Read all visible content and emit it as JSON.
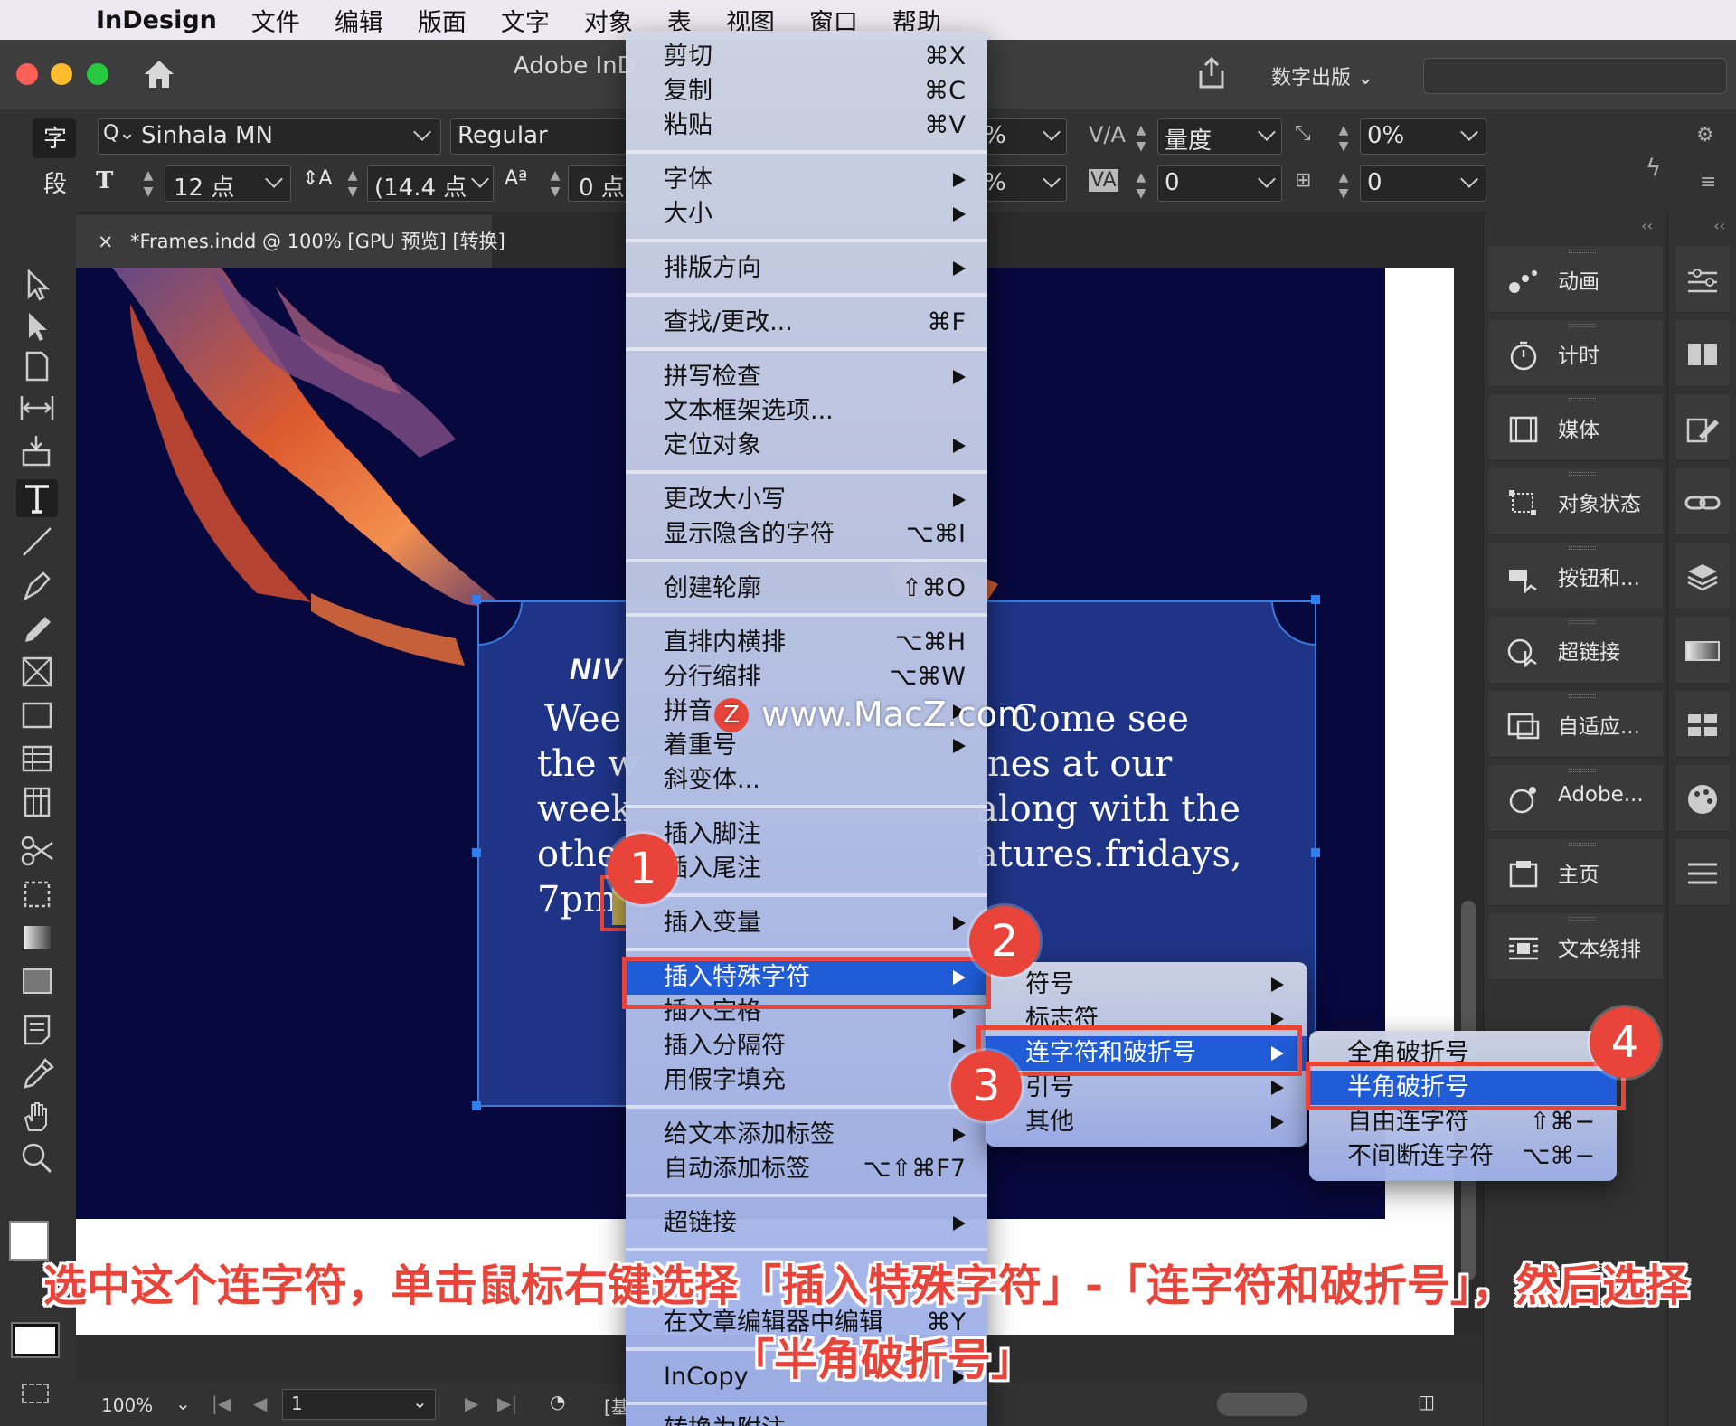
{
  "menubar": {
    "app": "InDesign",
    "items": [
      "文件",
      "编辑",
      "版面",
      "文字",
      "对象",
      "表",
      "视图",
      "窗口",
      "帮助"
    ]
  },
  "window": {
    "title": "Adobe InD",
    "publish_label": "数字出版"
  },
  "control": {
    "char_mode": "字",
    "para_mode": "段",
    "font_family": "Sinhala MN",
    "font_style": "Regular",
    "font_size": "12 点",
    "leading": "(14.4 点",
    "baseline_shift": "0 点",
    "scale_h": "%",
    "scale_v": "%",
    "kerning": "量度",
    "tracking": "0",
    "skew": "0%",
    "char_rotation": "0"
  },
  "tab": {
    "close": "×",
    "title": "*Frames.indd @ 100% [GPU 预览] [转换]"
  },
  "frame": {
    "title": "NIV",
    "lines": [
      "Wee",
      "the w",
      "week",
      "othe",
      "7pm"
    ],
    "right_lines": [
      "Come see",
      "nes at our",
      "along with the",
      "atures.fridays,"
    ]
  },
  "status": {
    "zoom": "100%",
    "page": "1",
    "base": "[基"
  },
  "right_panels": [
    {
      "label": "动画",
      "icon": "animation-icon"
    },
    {
      "label": "计时",
      "icon": "timer-icon"
    },
    {
      "label": "媒体",
      "icon": "media-icon"
    },
    {
      "label": "对象状态",
      "icon": "object-states-icon"
    },
    {
      "label": "按钮和...",
      "icon": "buttons-icon"
    },
    {
      "label": "超链接",
      "icon": "hyperlinks-icon"
    },
    {
      "label": "自适应...",
      "icon": "liquid-layout-icon"
    },
    {
      "label": "Adobe...",
      "icon": "adobe-color-icon"
    },
    {
      "label": "主页",
      "icon": "pages-icon"
    },
    {
      "label": "文本绕排",
      "icon": "text-wrap-icon"
    }
  ],
  "context_menu": {
    "items": [
      {
        "label": "剪切",
        "shortcut": "⌘X"
      },
      {
        "label": "复制",
        "shortcut": "⌘C"
      },
      {
        "label": "粘贴",
        "shortcut": "⌘V"
      },
      {
        "label": "字体",
        "submenu": true
      },
      {
        "label": "大小",
        "submenu": true
      },
      {
        "label": "排版方向",
        "submenu": true
      },
      {
        "label": "查找/更改...",
        "shortcut": "⌘F"
      },
      {
        "label": "拼写检查",
        "submenu": true
      },
      {
        "label": "文本框架选项..."
      },
      {
        "label": "定位对象",
        "submenu": true
      },
      {
        "label": "更改大小写",
        "submenu": true
      },
      {
        "label": "显示隐含的字符",
        "shortcut": "⌥⌘I"
      },
      {
        "label": "创建轮廓",
        "shortcut": "⇧⌘O"
      },
      {
        "label": "直排内横排",
        "shortcut": "⌥⌘H"
      },
      {
        "label": "分行缩排",
        "shortcut": "⌥⌘W"
      },
      {
        "label": "拼音",
        "submenu": true
      },
      {
        "label": "着重号",
        "submenu": true
      },
      {
        "label": "斜变体..."
      },
      {
        "label": "插入脚注"
      },
      {
        "label": "插入尾注"
      },
      {
        "label": "插入变量",
        "submenu": true
      },
      {
        "label": "插入特殊字符",
        "submenu": true,
        "selected": true
      },
      {
        "label": "插入空格",
        "submenu": true
      },
      {
        "label": "插入分隔符",
        "submenu": true
      },
      {
        "label": "用假字填充"
      },
      {
        "label": "给文本添加标签",
        "submenu": true
      },
      {
        "label": "自动添加标签",
        "shortcut": "⌥⇧⌘F7"
      },
      {
        "label": "超链接",
        "submenu": true
      },
      {
        "label": "在文章编辑器中编辑",
        "shortcut": "⌘Y"
      },
      {
        "label": "InCopy",
        "submenu": true
      },
      {
        "label": "转换为附注"
      }
    ]
  },
  "submenu_special": {
    "items": [
      {
        "label": "符号",
        "submenu": true
      },
      {
        "label": "标志符",
        "submenu": true
      },
      {
        "label": "连字符和破折号",
        "submenu": true,
        "selected": true
      },
      {
        "label": "引号",
        "submenu": true
      },
      {
        "label": "其他",
        "submenu": true
      }
    ]
  },
  "submenu_dash": {
    "items": [
      {
        "label": "全角破折号"
      },
      {
        "label": "半角破折号",
        "selected": true
      },
      {
        "label": "自由连字符",
        "shortcut": "⇧⌘−"
      },
      {
        "label": "不间断连字符",
        "shortcut": "⌥⌘−"
      }
    ]
  },
  "badges": [
    "1",
    "2",
    "3",
    "4"
  ],
  "watermark": {
    "logo": "Z",
    "text": "www.MacZ.com"
  },
  "caption": {
    "line1": "选中这个连字符，单击鼠标右键选择「插入特殊字符」-「连字符和破折号」，然后选择",
    "line2": "「半角破折号」"
  },
  "colors": {
    "accent_red": "#e8443a",
    "menu_selection": "#1f5cd6",
    "canvas": "#07083d",
    "frame": "#22388c"
  }
}
